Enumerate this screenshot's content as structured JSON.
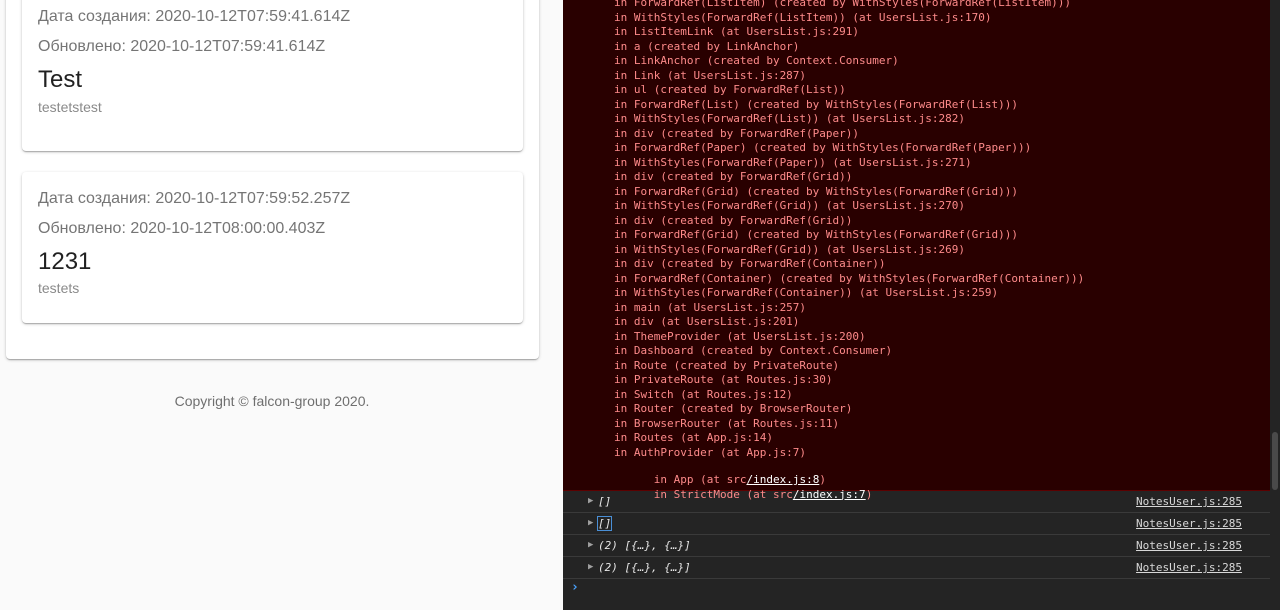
{
  "notes": [
    {
      "created": "Дата создания: 2020-10-12T07:59:41.614Z",
      "updated": "Обновлено: 2020-10-12T07:59:41.614Z",
      "title": "Test",
      "text": "testetstest"
    },
    {
      "created": "Дата создания: 2020-10-12T07:59:52.257Z",
      "updated": "Обновлено: 2020-10-12T08:00:00.403Z",
      "title": "1231",
      "text": "testets"
    }
  ],
  "footer": {
    "copyright": "Copyright © falcon-group 2020."
  },
  "console": {
    "stack": [
      "in ForwardRef(ListItem) (created by WithStyles(ForwardRef(ListItem)))",
      "in WithStyles(ForwardRef(ListItem)) (at UsersList.js:170)",
      "in ListItemLink (at UsersList.js:291)",
      "in a (created by LinkAnchor)",
      "in LinkAnchor (created by Context.Consumer)",
      "in Link (at UsersList.js:287)",
      "in ul (created by ForwardRef(List))",
      "in ForwardRef(List) (created by WithStyles(ForwardRef(List)))",
      "in WithStyles(ForwardRef(List)) (at UsersList.js:282)",
      "in div (created by ForwardRef(Paper))",
      "in ForwardRef(Paper) (created by WithStyles(ForwardRef(Paper)))",
      "in WithStyles(ForwardRef(Paper)) (at UsersList.js:271)",
      "in div (created by ForwardRef(Grid))",
      "in ForwardRef(Grid) (created by WithStyles(ForwardRef(Grid)))",
      "in WithStyles(ForwardRef(Grid)) (at UsersList.js:270)",
      "in div (created by ForwardRef(Grid))",
      "in ForwardRef(Grid) (created by WithStyles(ForwardRef(Grid)))",
      "in WithStyles(ForwardRef(Grid)) (at UsersList.js:269)",
      "in div (created by ForwardRef(Container))",
      "in ForwardRef(Container) (created by WithStyles(ForwardRef(Container)))",
      "in WithStyles(ForwardRef(Container)) (at UsersList.js:259)",
      "in main (at UsersList.js:257)",
      "in div (at UsersList.js:201)",
      "in ThemeProvider (at UsersList.js:200)",
      "in Dashboard (created by Context.Consumer)",
      "in Route (created by PrivateRoute)",
      "in PrivateRoute (at Routes.js:30)",
      "in Switch (at Routes.js:12)",
      "in Router (created by BrowserRouter)",
      "in BrowserRouter (at Routes.js:11)",
      "in Routes (at App.js:14)",
      "in AuthProvider (at App.js:7)"
    ],
    "stack_app_prefix": "in App (at src",
    "stack_app_link": "/index.js:8",
    "stack_app_suffix": ")",
    "stack_strict_prefix": "in StrictMode (at src",
    "stack_strict_link": "/index.js:7",
    "stack_strict_suffix": ")",
    "logs": [
      {
        "text": "[]",
        "source": "NotesUser.js:285"
      },
      {
        "text": "[]",
        "source": "NotesUser.js:285"
      },
      {
        "text": "(2) [{…}, {…}]",
        "source": "NotesUser.js:285"
      },
      {
        "text": "(2) [{…}, {…}]",
        "source": "NotesUser.js:285"
      }
    ],
    "expand_icon": "triangle-right-icon",
    "prompt_icon": "chevron-right-icon"
  }
}
